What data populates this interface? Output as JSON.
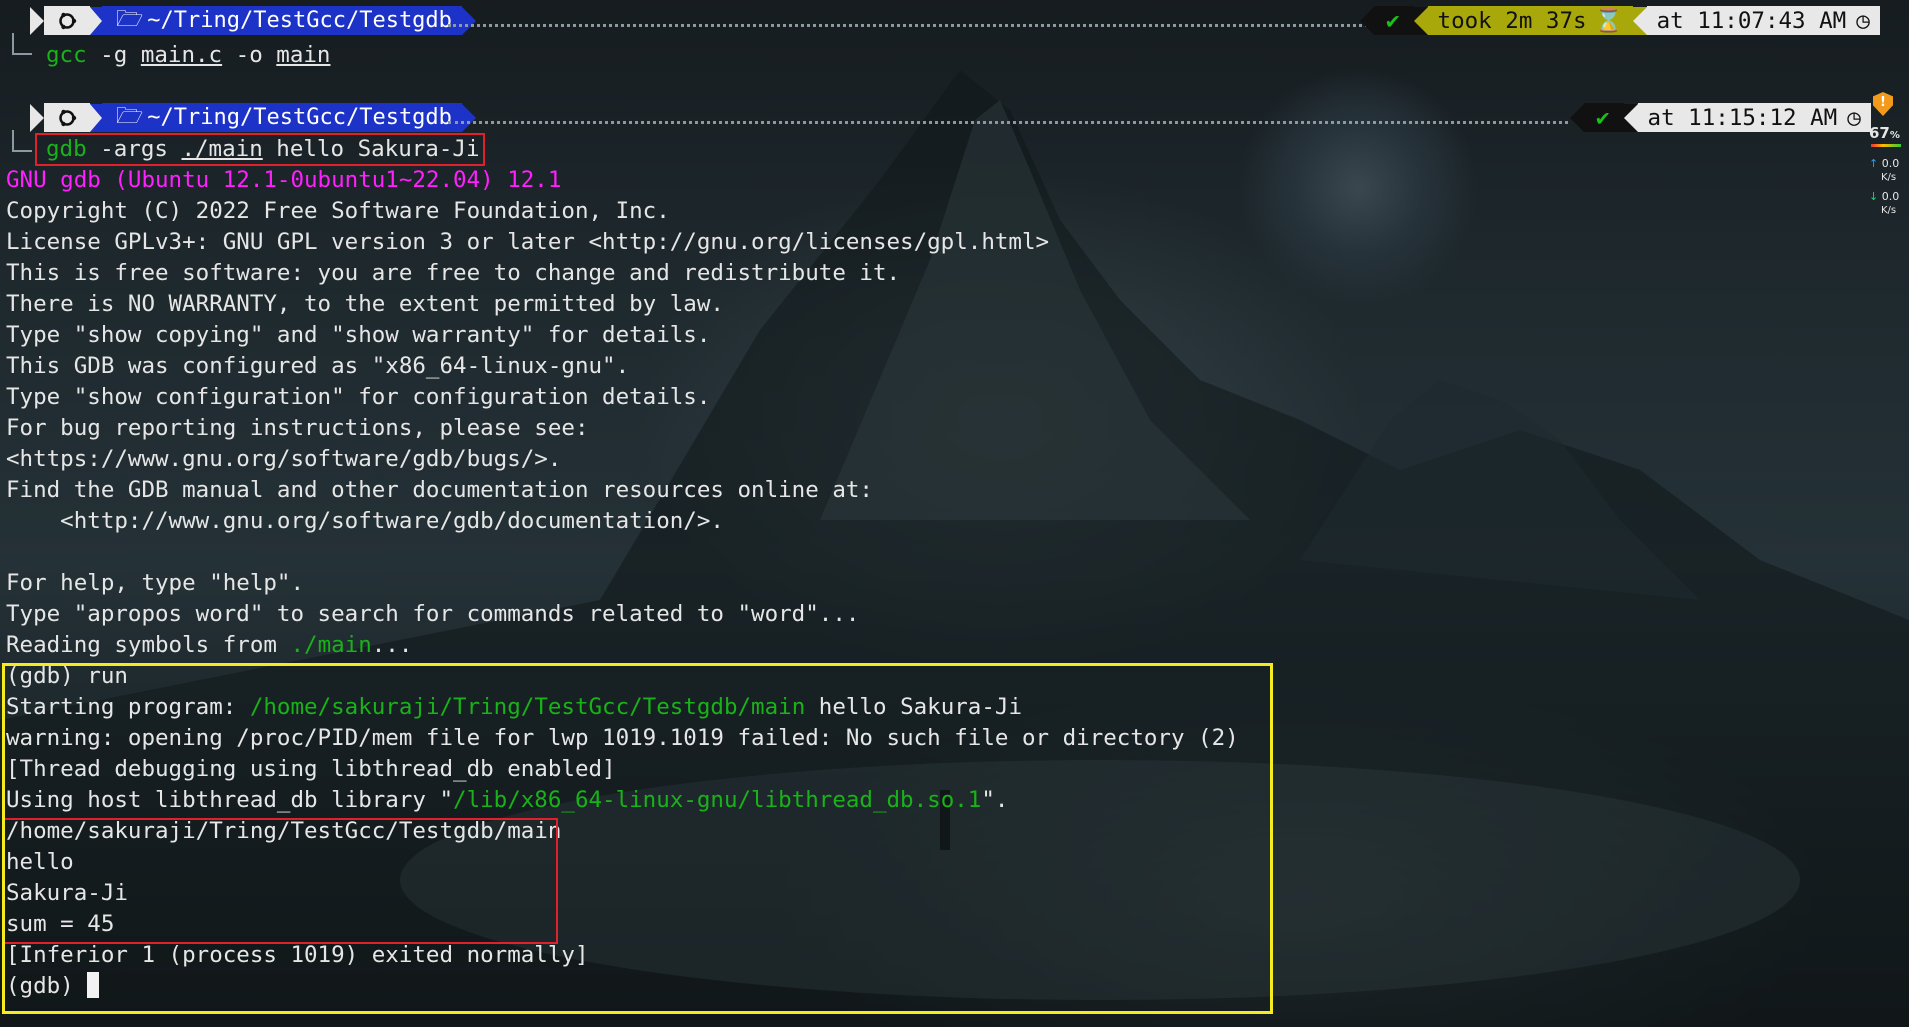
{
  "prompt1": {
    "path": "~/Tring/TestGcc/Testgdb",
    "command": {
      "cmd": "gcc",
      "a1": " -g ",
      "file": "main.c",
      "a2": " -o ",
      "out": "main"
    },
    "status_ok": "✔",
    "took": "took 2m 37s",
    "time": "at 11:07:43 AM"
  },
  "prompt2": {
    "path": "~/Tring/TestGcc/Testgdb",
    "command": {
      "cmd": "gdb",
      "a1": " -args ",
      "prog": "./main",
      "a2": " hello Sakura-Ji"
    },
    "status_ok": "✔",
    "time": "at 11:15:12 AM"
  },
  "output": {
    "banner": "GNU gdb (Ubuntu 12.1-0ubuntu1~22.04) 12.1",
    "lines": [
      "Copyright (C) 2022 Free Software Foundation, Inc.",
      "License GPLv3+: GNU GPL version 3 or later <http://gnu.org/licenses/gpl.html>",
      "This is free software: you are free to change and redistribute it.",
      "There is NO WARRANTY, to the extent permitted by law.",
      "Type \"show copying\" and \"show warranty\" for details.",
      "This GDB was configured as \"x86_64-linux-gnu\".",
      "Type \"show configuration\" for configuration details.",
      "For bug reporting instructions, please see:",
      "<https://www.gnu.org/software/gdb/bugs/>.",
      "Find the GDB manual and other documentation resources online at:",
      "    <http://www.gnu.org/software/gdb/documentation/>.",
      "",
      "For help, type \"help\".",
      "Type \"apropos word\" to search for commands related to \"word\"..."
    ],
    "reading_prefix": "Reading symbols from ",
    "reading_path": "./main",
    "reading_suffix": "...",
    "run_cmd": "(gdb) run",
    "starting_prefix": "Starting program: ",
    "starting_path": "/home/sakuraji/Tring/TestGcc/Testgdb/main",
    "starting_suffix": " hello Sakura-Ji",
    "warning": "warning: opening /proc/PID/mem file for lwp 1019.1019 failed: No such file or directory (2)",
    "thread_debug": "[Thread debugging using libthread_db enabled]",
    "host_prefix": "Using host libthread_db library \"",
    "host_path": "/lib/x86_64-linux-gnu/libthread_db.so.1",
    "host_suffix": "\".",
    "program_output": [
      "/home/sakuraji/Tring/TestGcc/Testgdb/main",
      "hello",
      "Sakura-Ji",
      "sum = 45"
    ],
    "exited": "[Inferior 1 (process 1019) exited normally]",
    "final_prompt": "(gdb) "
  },
  "widget": {
    "percent": "67",
    "percent_unit": "%",
    "up_value": "0.0",
    "up_unit": "K/s",
    "down_value": "0.0",
    "down_unit": "K/s"
  },
  "colors": {
    "green": "#19b219",
    "magenta": "#ff1fff",
    "path_segment": "#1d33c8",
    "took_segment": "#a8a80a",
    "red_box": "#e0212b",
    "yellow_box": "#f4ec1e"
  }
}
